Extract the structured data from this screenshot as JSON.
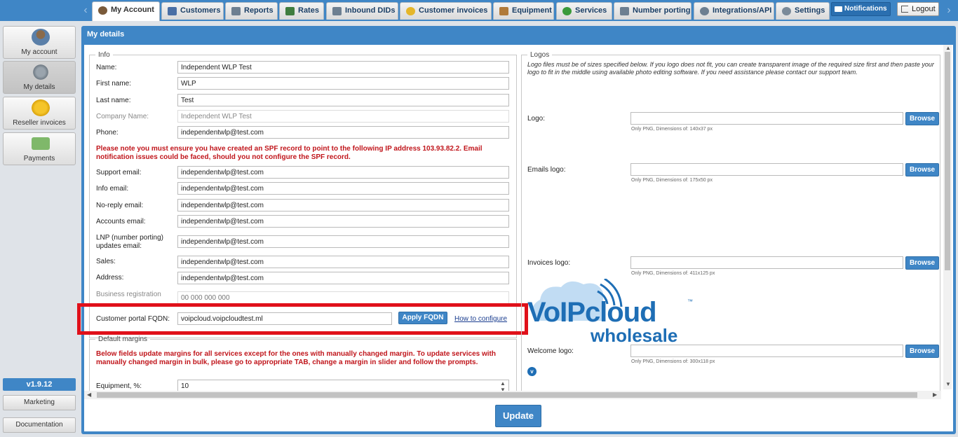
{
  "nav": {
    "tabs": [
      {
        "label": "My Account",
        "icon": "user-icon",
        "color": "#7a5a3a"
      },
      {
        "label": "Customers",
        "icon": "customers-icon",
        "color": "#4a6fa5"
      },
      {
        "label": "Reports",
        "icon": "reports-icon",
        "color": "#6d7f91"
      },
      {
        "label": "Rates",
        "icon": "rates-icon",
        "color": "#3f7d3f"
      },
      {
        "label": "Inbound DIDs",
        "icon": "inbound-icon",
        "color": "#6d7f91"
      },
      {
        "label": "Customer invoices",
        "icon": "invoice-coins-icon",
        "color": "#e5b62a"
      },
      {
        "label": "Equipment",
        "icon": "equipment-icon",
        "color": "#b07a3a"
      },
      {
        "label": "Services",
        "icon": "services-icon",
        "color": "#3a9a3a"
      },
      {
        "label": "Number porting",
        "icon": "porting-icon",
        "color": "#6d7f91"
      },
      {
        "label": "Integrations/API",
        "icon": "integrations-icon",
        "color": "#6d7f91"
      },
      {
        "label": "Settings",
        "icon": "settings-icon",
        "color": "#7a8a99"
      }
    ],
    "notifications_label": "Notifications",
    "logout_label": "Logout"
  },
  "sidebar": {
    "items": [
      {
        "label": "My account",
        "icon": "user-avatar-icon"
      },
      {
        "label": "My details",
        "icon": "gears-icon"
      },
      {
        "label": "Reseller invoices",
        "icon": "coins-icon"
      },
      {
        "label": "Payments",
        "icon": "payment-add-icon"
      }
    ],
    "version": "v1.9.12",
    "marketing_label": "Marketing",
    "documentation_label": "Documentation"
  },
  "panel": {
    "title": "My details"
  },
  "info": {
    "legend": "Info",
    "fields_top": [
      {
        "label": "Name:",
        "value": "Independent WLP Test"
      },
      {
        "label": "First name:",
        "value": "WLP"
      },
      {
        "label": "Last name:",
        "value": "Test"
      },
      {
        "label": "Company Name:",
        "value": "Independent WLP Test"
      },
      {
        "label": "Phone:",
        "value": "independentwlp@test.com"
      }
    ],
    "spf_warning": "Please note you must ensure you have created an SPF record to point to the following IP address 103.93.82.2. Email notification issues could be faced, should you not configure the SPF record.",
    "fields_email": [
      {
        "label": "Support email:",
        "value": "independentwlp@test.com"
      },
      {
        "label": "Info email:",
        "value": "independentwlp@test.com"
      },
      {
        "label": "No-reply email:",
        "value": "independentwlp@test.com"
      },
      {
        "label": "Accounts email:",
        "value": "independentwlp@test.com"
      },
      {
        "label": "LNP (number porting) updates email:",
        "value": "independentwlp@test.com"
      },
      {
        "label": "Sales:",
        "value": "independentwlp@test.com"
      },
      {
        "label": "Address:",
        "value": "independentwlp@test.com"
      }
    ],
    "business_reg_label": "Business registration",
    "business_reg_placeholder": "00 000 000 000",
    "fqdn_label": "Customer portal FQDN:",
    "fqdn_value": "voipcloud.voipcloudtest.ml",
    "apply_label": "Apply FQDN",
    "how_to_label": "How to configure"
  },
  "margins": {
    "legend": "Default margins",
    "warning": "Below fields update margins for all services except for the ones with manually changed margin. To update services with manually changed margin in bulk, please go to appropriate TAB, change a margin in slider and follow the prompts.",
    "equipment_label": "Equipment, %:",
    "equipment_value": "10"
  },
  "logos": {
    "legend": "Logos",
    "note": "Logo files must be of sizes specified below. If you logo does not fit, you can create transparent image of the required size first and then paste your logo to fit in the middle using available photo editing software. If you need assistance please contact our support team.",
    "browse_label": "Browse",
    "items": [
      {
        "label": "Logo:",
        "hint": "Only PNG, Dimensions of: 140x37 px"
      },
      {
        "label": "Emails logo:",
        "hint": "Only PNG, Dimensions of: 175x50 px"
      },
      {
        "label": "Invoices logo:",
        "hint": "Only PNG, Dimensions of: 411x125 px"
      },
      {
        "label": "Welcome logo:",
        "hint": "Only PNG, Dimensions of: 300x118 px"
      }
    ],
    "brand_main": "VoIPcloud",
    "brand_sub": "wholesale",
    "brand_tm": "™"
  },
  "update_label": "Update",
  "colors": {
    "accent": "#3f86c6",
    "warning": "#c0151b",
    "highlight": "#e0101a"
  }
}
